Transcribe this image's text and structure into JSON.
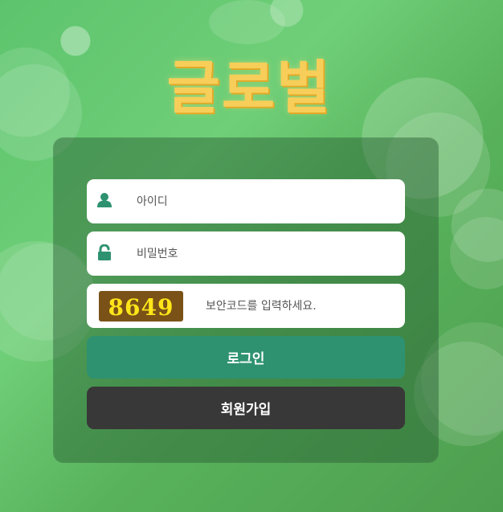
{
  "brand": {
    "logo_text": "글로벌"
  },
  "login_form": {
    "id_placeholder": "아이디",
    "password_placeholder": "비밀번호",
    "captcha_code": "8649",
    "captcha_placeholder": "보안코드를 입력하세요.",
    "login_button_label": "로그인",
    "signup_button_label": "회원가입"
  },
  "colors": {
    "logo": "#f7ce59",
    "login_button": "#2e9270",
    "signup_button": "#383838",
    "captcha_background": "#7a5218",
    "captcha_text": "#ffe51a",
    "icon": "#2e9270"
  },
  "icons": {
    "user": "user-icon",
    "lock": "unlock-icon"
  }
}
